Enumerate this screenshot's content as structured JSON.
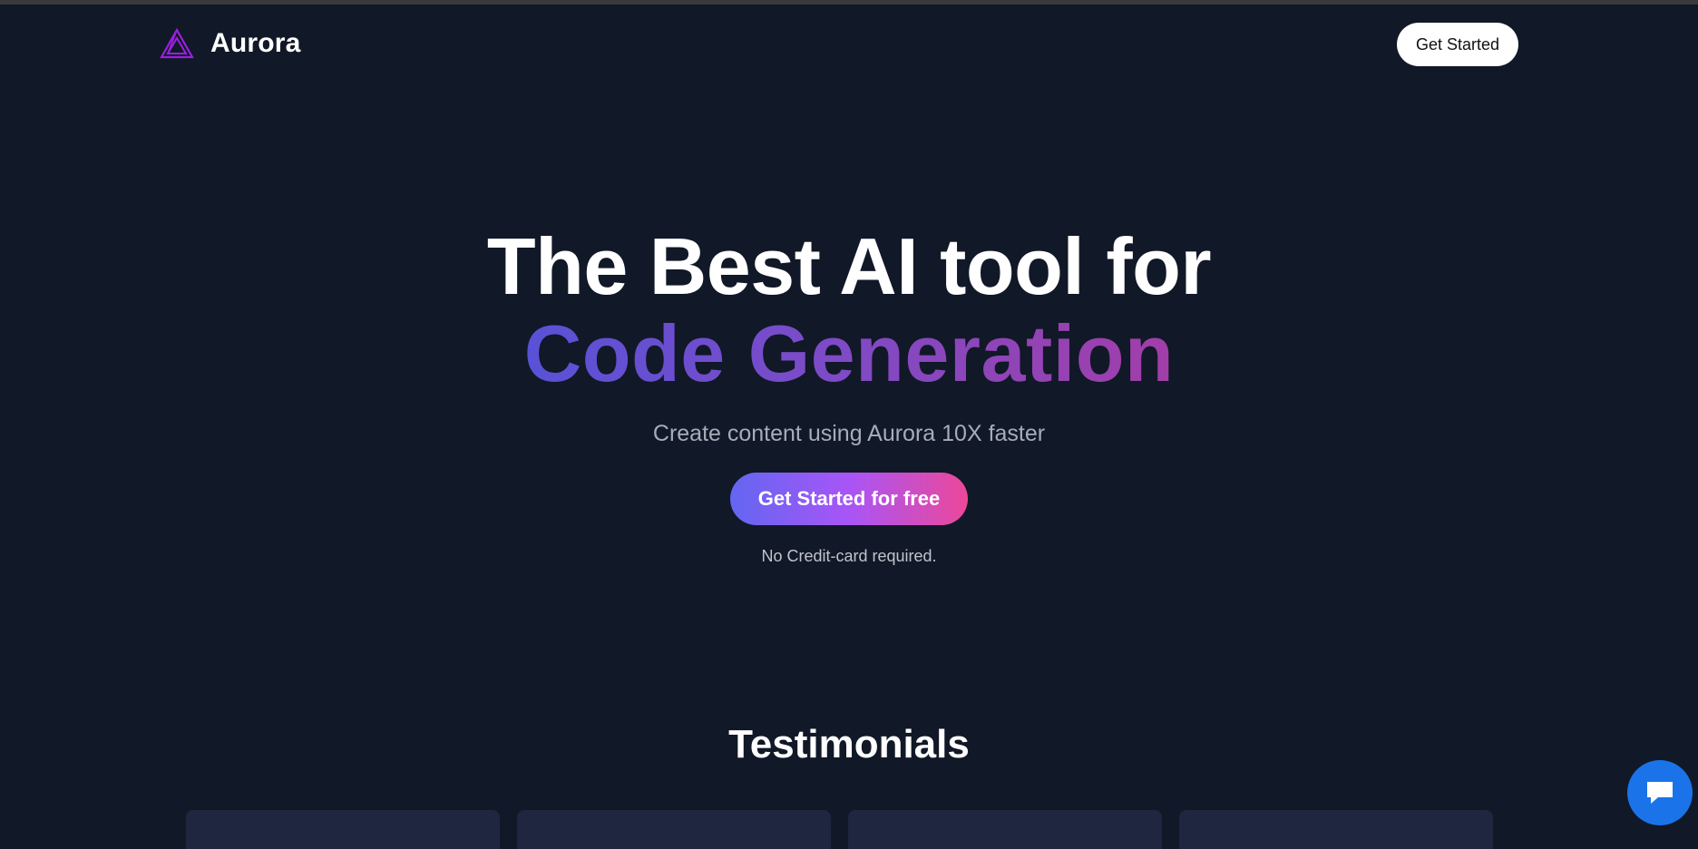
{
  "brand": {
    "name": "Aurora",
    "logo_icon": "triangle-logo-icon",
    "accent": "#9b1fe0"
  },
  "nav": {
    "cta_label": "Get Started"
  },
  "hero": {
    "title_line1": "The Best AI tool for",
    "title_line2": "Code Generation",
    "subtitle": "Create content using Aurora 10X faster",
    "cta_label": "Get Started for free",
    "note": "No Credit-card required.",
    "gradient_colors": [
      "#6366f1",
      "#a855f7",
      "#ec4899"
    ]
  },
  "testimonials": {
    "heading": "Testimonials",
    "cards": [
      {
        "name": ""
      },
      {
        "name": ""
      },
      {
        "name": ""
      },
      {
        "name": ""
      }
    ]
  },
  "chat": {
    "icon": "chat-bubble-icon",
    "color": "#1a73e8"
  },
  "colors": {
    "background": "#111827",
    "card": "#1e2640"
  }
}
